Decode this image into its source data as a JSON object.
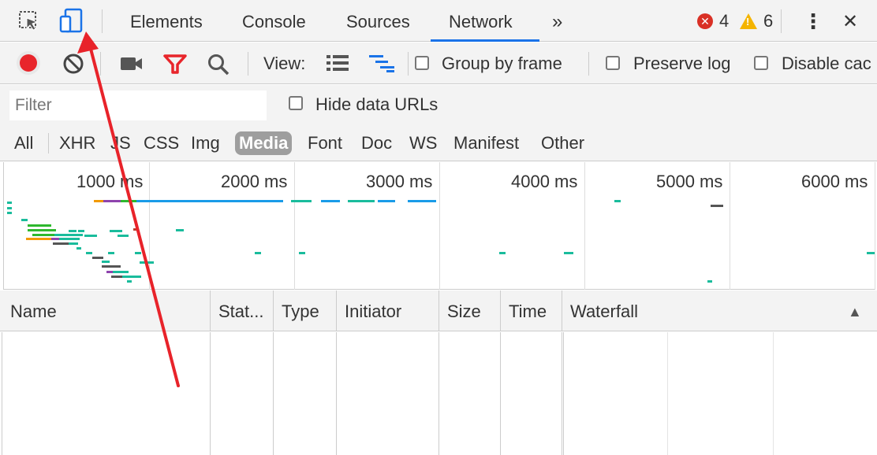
{
  "tabs": [
    {
      "label": "Elements",
      "active": false
    },
    {
      "label": "Console",
      "active": false
    },
    {
      "label": "Sources",
      "active": false
    },
    {
      "label": "Network",
      "active": true
    }
  ],
  "more_tabs": "»",
  "errors_count": "4",
  "warnings_count": "6",
  "menu_icon": "⋮",
  "close_icon": "✕",
  "toolbar": {
    "view_label": "View:",
    "group_by_frame": "Group by frame",
    "preserve_log": "Preserve log",
    "disable_cache": "Disable cac"
  },
  "filter": {
    "placeholder": "Filter",
    "hide_data_urls": "Hide data URLs"
  },
  "types": [
    "All",
    "XHR",
    "JS",
    "CSS",
    "Img",
    "Media",
    "Font",
    "Doc",
    "WS",
    "Manifest",
    "Other"
  ],
  "active_type": "Media",
  "timeline_ticks": [
    "1000 ms",
    "2000 ms",
    "3000 ms",
    "4000 ms",
    "5000 ms",
    "6000 ms"
  ],
  "columns": [
    "Name",
    "Stat...",
    "Type",
    "Initiator",
    "Size",
    "Time",
    "Waterfall"
  ],
  "sort_indicator": "▲",
  "colors": {
    "accent": "#1a73e8",
    "record": "#e8252b",
    "filter_icon": "#e8252b",
    "annotation_arrow": "#e8232a"
  }
}
